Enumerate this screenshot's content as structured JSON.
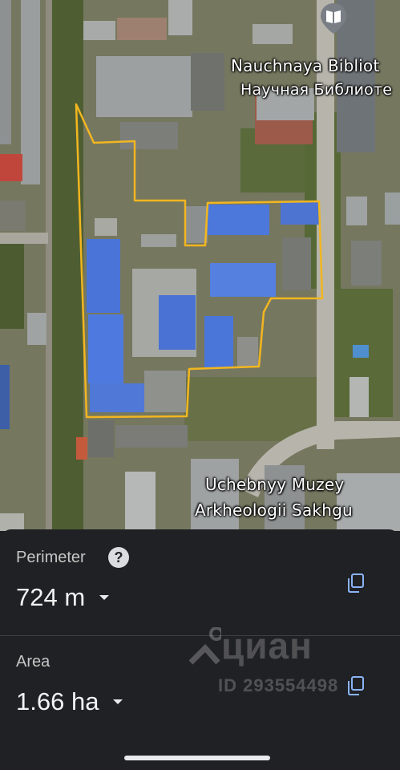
{
  "map": {
    "labels": {
      "library_en": "Nauchnaya Bibliot",
      "library_ru": "Научная Библиоте",
      "museum_line1": "Uchebnyy Muzey",
      "museum_line2": "Arkheologii Sakhgu"
    },
    "icons": {
      "pin": "library-book-pin-icon"
    },
    "colors": {
      "boundary": "#f2b620",
      "roof_blue": "#4a74d8",
      "vegetation": "#5e6b3a"
    }
  },
  "panel": {
    "perimeter_label": "Perimeter",
    "perimeter_value": "724 m",
    "area_label": "Area",
    "area_value": "1.66 ha",
    "help_glyph": "?"
  },
  "watermark": {
    "logo": "циан",
    "id": "ID 293554498"
  }
}
